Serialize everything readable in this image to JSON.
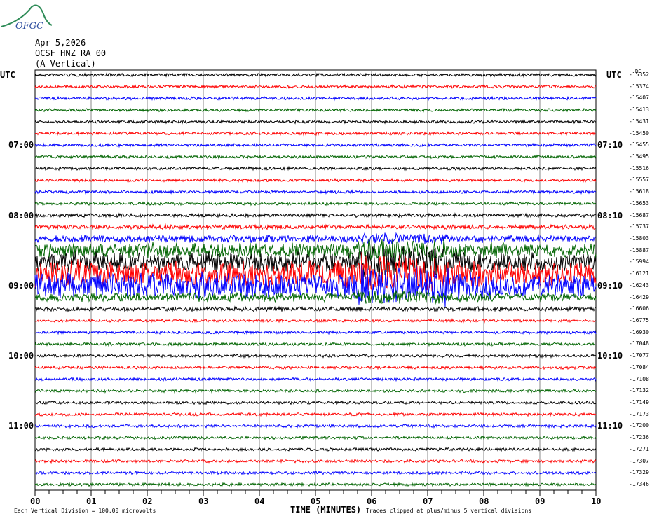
{
  "header": {
    "logo": "OFGC",
    "date": "Apr 5,2026",
    "station": "OCSF HNZ RA 00",
    "component": "(A Vertical)"
  },
  "chart_data": {
    "type": "line",
    "title": "OCSF HNZ RA 00 (A Vertical)",
    "xlabel": "TIME (MINUTES)",
    "xlim": [
      0,
      10
    ],
    "x_ticks": [
      "00",
      "01",
      "02",
      "03",
      "04",
      "05",
      "06",
      "07",
      "08",
      "09",
      "10"
    ],
    "left_axis_label": "UTC",
    "right_axis_label": "UTC",
    "dc_label": "DC",
    "left_hour_labels": [
      {
        "row": 6,
        "label": "07:00"
      },
      {
        "row": 12,
        "label": "08:00"
      },
      {
        "row": 18,
        "label": "09:00"
      },
      {
        "row": 24,
        "label": "10:00"
      },
      {
        "row": 30,
        "label": "11:00"
      }
    ],
    "right_hour_labels": [
      {
        "row": 6,
        "label": "07:10"
      },
      {
        "row": 12,
        "label": "08:10"
      },
      {
        "row": 18,
        "label": "09:10"
      },
      {
        "row": 24,
        "label": "10:10"
      },
      {
        "row": 30,
        "label": "11:10"
      }
    ],
    "trace_colors": [
      "#000000",
      "#ff0000",
      "#0000ff",
      "#006400"
    ],
    "dc_offsets": [
      "-15352",
      "-15374",
      "-15407",
      "-15413",
      "-15431",
      "-15450",
      "-15455",
      "-15495",
      "-15516",
      "-15557",
      "-15618",
      "-15653",
      "-15687",
      "-15737",
      "-15803",
      "-15887",
      "-15994",
      "-16121",
      "-16243",
      "-16429",
      "-16606",
      "-16775",
      "-16930",
      "-17048",
      "-17077",
      "-17084",
      "-17108",
      "-17132",
      "-17149",
      "-17173",
      "-17200",
      "-17236",
      "-17271",
      "-17307",
      "-17329",
      "-17346"
    ],
    "trace_noise_level": [
      1,
      1,
      1,
      1,
      1,
      1,
      1,
      1,
      1,
      1,
      1,
      1,
      1.2,
      1.5,
      2.5,
      5,
      7,
      9,
      9,
      3,
      1.5,
      1,
      1,
      1,
      1,
      1,
      1,
      1,
      1,
      1,
      1,
      1,
      1,
      1,
      1,
      1
    ],
    "footer_left": "Each Vertical Division =  100.00 microvolts",
    "footer_right": "Traces clipped at plus/minus 5 vertical divisions"
  }
}
